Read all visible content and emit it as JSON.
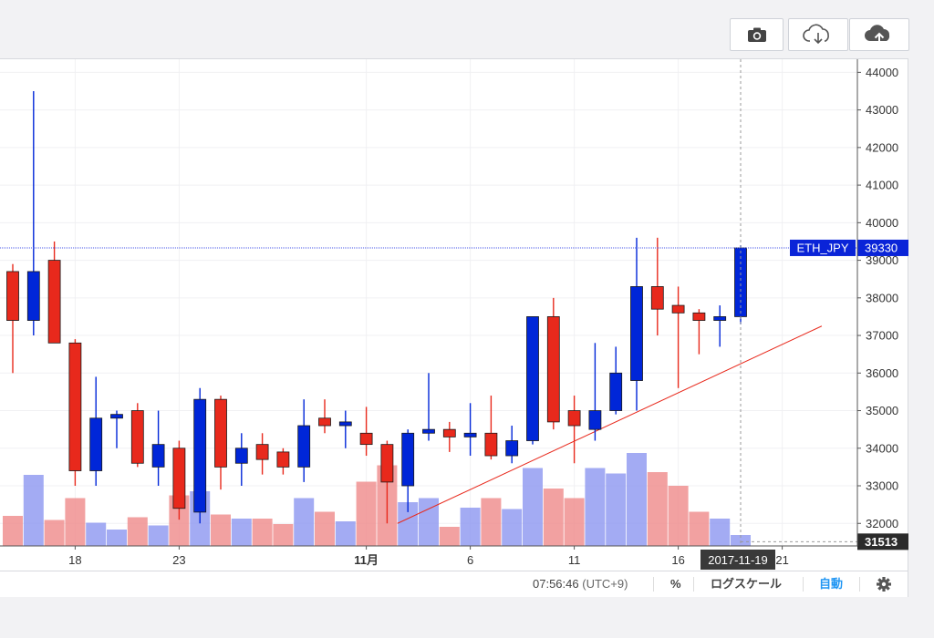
{
  "toolbar": {
    "snapshot_icon": "camera-icon",
    "load_icon": "cloud-download-icon",
    "save_icon": "cloud-upload-icon"
  },
  "statusbar": {
    "time": "07:56:46",
    "timezone": "(UTC+9)",
    "percent_label": "%",
    "log_label": "ログスケール",
    "auto_label": "自動",
    "settings_icon": "gear-icon",
    "accent_color": "#2196f3"
  },
  "chart_data": {
    "type": "candlestick",
    "symbol": "ETH_JPY",
    "last_price_label": "39330",
    "cursor_price_label": "31513",
    "cursor_date_label": "2017-11-19",
    "y_range": [
      31400,
      44300
    ],
    "y_ticks": [
      32000,
      33000,
      34000,
      35000,
      36000,
      37000,
      38000,
      39000,
      40000,
      41000,
      42000,
      43000,
      44000
    ],
    "x_ticks": [
      {
        "index": 3,
        "label": "18",
        "bold": false
      },
      {
        "index": 8,
        "label": "23",
        "bold": false
      },
      {
        "index": 17,
        "label": "11月",
        "bold": true
      },
      {
        "index": 22,
        "label": "6",
        "bold": false
      },
      {
        "index": 27,
        "label": "11",
        "bold": false
      },
      {
        "index": 32,
        "label": "16",
        "bold": false
      },
      {
        "index": 37,
        "label": "21",
        "bold": false
      }
    ],
    "up_color": "#0026d8",
    "down_color": "#e8291c",
    "candles": [
      {
        "o": 38700,
        "h": 38900,
        "l": 36000,
        "c": 37400
      },
      {
        "o": 37400,
        "h": 43500,
        "l": 37000,
        "c": 38700
      },
      {
        "o": 39000,
        "h": 39500,
        "l": 36800,
        "c": 36800
      },
      {
        "o": 36800,
        "h": 36900,
        "l": 33000,
        "c": 33400
      },
      {
        "o": 33400,
        "h": 35900,
        "l": 33000,
        "c": 34800
      },
      {
        "o": 34800,
        "h": 35000,
        "l": 34000,
        "c": 34900
      },
      {
        "o": 35000,
        "h": 35200,
        "l": 33500,
        "c": 33600
      },
      {
        "o": 33500,
        "h": 35000,
        "l": 33000,
        "c": 34100
      },
      {
        "o": 34000,
        "h": 34200,
        "l": 32100,
        "c": 32400
      },
      {
        "o": 32300,
        "h": 35600,
        "l": 32000,
        "c": 35300
      },
      {
        "o": 35300,
        "h": 35400,
        "l": 32900,
        "c": 33500
      },
      {
        "o": 33600,
        "h": 34400,
        "l": 33000,
        "c": 34000
      },
      {
        "o": 34100,
        "h": 34400,
        "l": 33300,
        "c": 33700
      },
      {
        "o": 33900,
        "h": 34000,
        "l": 33300,
        "c": 33500
      },
      {
        "o": 33500,
        "h": 35300,
        "l": 33100,
        "c": 34600
      },
      {
        "o": 34800,
        "h": 35300,
        "l": 34400,
        "c": 34600
      },
      {
        "o": 34600,
        "h": 35000,
        "l": 34000,
        "c": 34700
      },
      {
        "o": 34400,
        "h": 35100,
        "l": 33800,
        "c": 34100
      },
      {
        "o": 34100,
        "h": 34200,
        "l": 32000,
        "c": 33100
      },
      {
        "o": 33000,
        "h": 34500,
        "l": 32300,
        "c": 34400
      },
      {
        "o": 34400,
        "h": 36000,
        "l": 34200,
        "c": 34500
      },
      {
        "o": 34500,
        "h": 34700,
        "l": 33900,
        "c": 34300
      },
      {
        "o": 34300,
        "h": 35200,
        "l": 33800,
        "c": 34400
      },
      {
        "o": 34400,
        "h": 35400,
        "l": 33700,
        "c": 33800
      },
      {
        "o": 33800,
        "h": 34600,
        "l": 33600,
        "c": 34200
      },
      {
        "o": 34200,
        "h": 37500,
        "l": 34100,
        "c": 37500
      },
      {
        "o": 37500,
        "h": 38000,
        "l": 34500,
        "c": 34700
      },
      {
        "o": 35000,
        "h": 35400,
        "l": 33600,
        "c": 34600
      },
      {
        "o": 34500,
        "h": 36800,
        "l": 34200,
        "c": 35000
      },
      {
        "o": 35000,
        "h": 36700,
        "l": 34900,
        "c": 36000
      },
      {
        "o": 35800,
        "h": 39600,
        "l": 35000,
        "c": 38300
      },
      {
        "o": 38300,
        "h": 39600,
        "l": 37000,
        "c": 37700
      },
      {
        "o": 37800,
        "h": 38300,
        "l": 35600,
        "c": 37600
      },
      {
        "o": 37600,
        "h": 37700,
        "l": 36500,
        "c": 37400
      },
      {
        "o": 37400,
        "h": 37800,
        "l": 36700,
        "c": 37500
      },
      {
        "o": 37500,
        "h": 39400,
        "l": 37300,
        "c": 39330
      }
    ],
    "volume": {
      "max": 100,
      "up_color": "#8c96f0",
      "down_color": "#ef8a8a",
      "values": [
        22,
        52,
        19,
        35,
        17,
        12,
        21,
        15,
        37,
        40,
        23,
        20,
        20,
        16,
        35,
        25,
        18,
        47,
        59,
        32,
        35,
        14,
        28,
        35,
        27,
        57,
        42,
        35,
        57,
        53,
        68,
        54,
        44,
        25,
        20,
        8
      ]
    },
    "trendline": {
      "from": {
        "index": 18.5,
        "price": 32000
      },
      "to": {
        "index": 38.9,
        "price": 37250
      }
    }
  }
}
